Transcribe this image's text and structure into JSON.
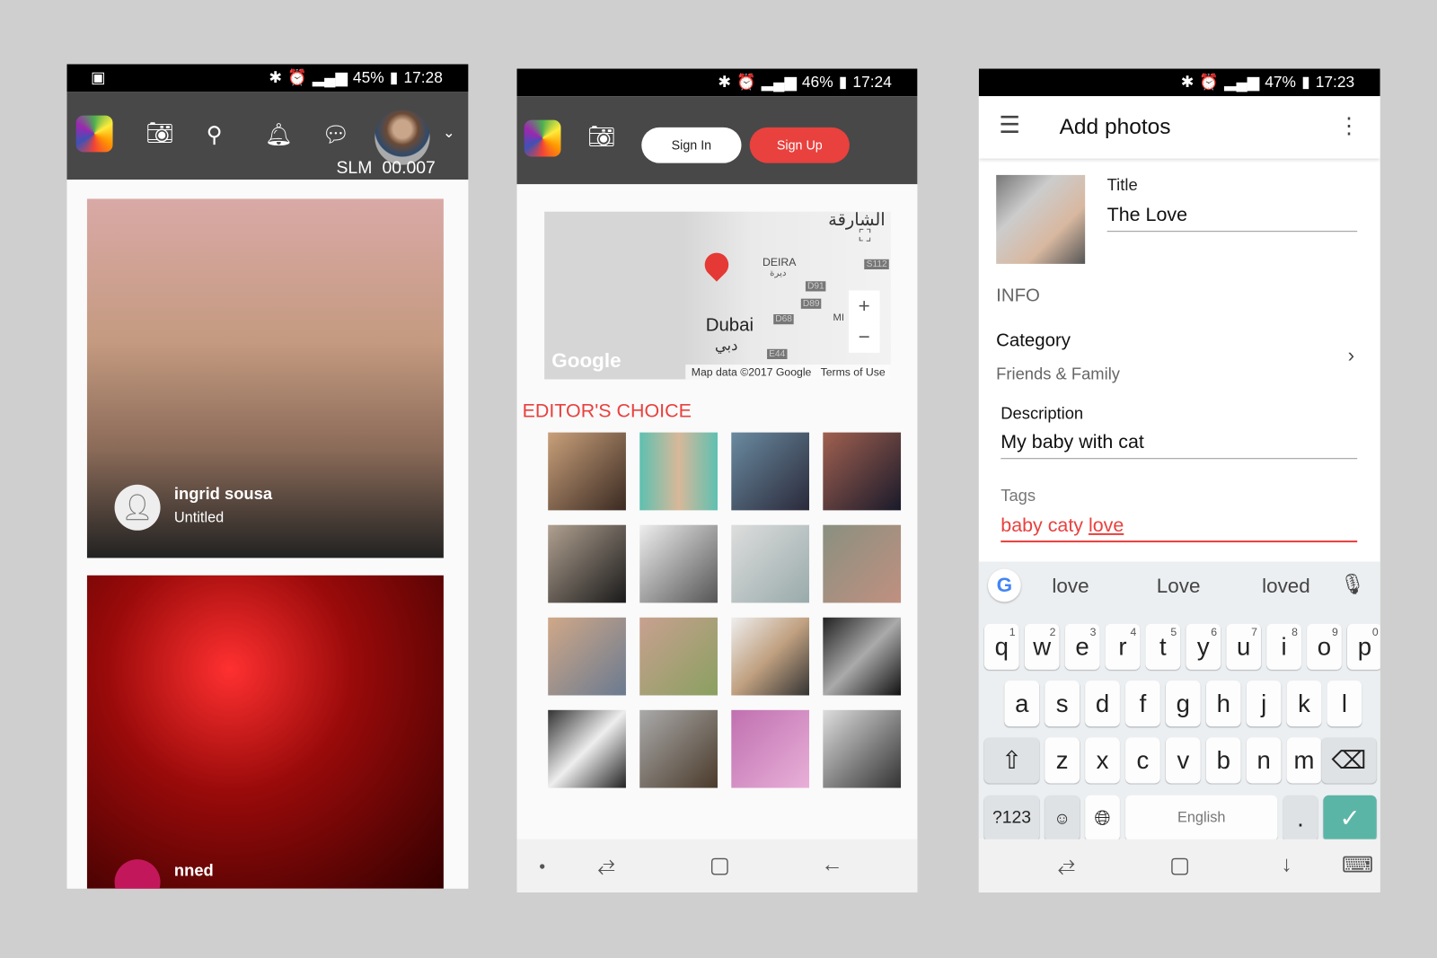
{
  "screen1": {
    "status": {
      "icons": [
        "image-icon",
        "bluetooth-icon",
        "alarm-icon",
        "signal-icon",
        "battery-icon"
      ],
      "battery": "45%",
      "time": "17:28"
    },
    "appbar": {
      "balance_label": "SLM",
      "balance_value": "00.007"
    },
    "posts": [
      {
        "user": "ingrid sousa",
        "title": "Untitled"
      },
      {
        "user": "nned"
      }
    ]
  },
  "screen2": {
    "status": {
      "battery": "46%",
      "time": "17:24"
    },
    "appbar": {
      "sign_in": "Sign In",
      "sign_up": "Sign Up"
    },
    "map": {
      "city": "Dubai",
      "city_ar": "دبي",
      "district": "DEIRA",
      "district_ar": "ديرة",
      "region_ar": "الشارقة",
      "roads": [
        "S112",
        "D91",
        "D89",
        "D68",
        "E44"
      ],
      "mi": "MI",
      "logo": "Google",
      "attribution": "Map data ©2017 Google",
      "terms": "Terms of Use"
    },
    "section_title": "EDITOR'S CHOICE"
  },
  "screen3": {
    "status": {
      "battery": "47%",
      "time": "17:23"
    },
    "title": "Add photos",
    "form": {
      "title_label": "Title",
      "title_value": "The Love",
      "info": "INFO",
      "category_label": "Category",
      "category_value": "Friends & Family",
      "description_label": "Description",
      "description_value": "My baby with cat",
      "tags_label": "Tags",
      "tags_value": "baby caty ",
      "tags_current": "love"
    },
    "keyboard": {
      "suggestions": [
        "love",
        "Love",
        "loved"
      ],
      "row1": [
        [
          "q",
          "1"
        ],
        [
          "w",
          "2"
        ],
        [
          "e",
          "3"
        ],
        [
          "r",
          "4"
        ],
        [
          "t",
          "5"
        ],
        [
          "y",
          "6"
        ],
        [
          "u",
          "7"
        ],
        [
          "i",
          "8"
        ],
        [
          "o",
          "9"
        ],
        [
          "p",
          "0"
        ]
      ],
      "row2": [
        "a",
        "s",
        "d",
        "f",
        "g",
        "h",
        "j",
        "k",
        "l"
      ],
      "row3": [
        "z",
        "x",
        "c",
        "v",
        "b",
        "n",
        "m"
      ],
      "symbols": "?123",
      "space": "English",
      "period": "."
    }
  },
  "colors": {
    "accent": "#e8413e",
    "appbar": "#484848",
    "enter": "#5bb5a6"
  }
}
